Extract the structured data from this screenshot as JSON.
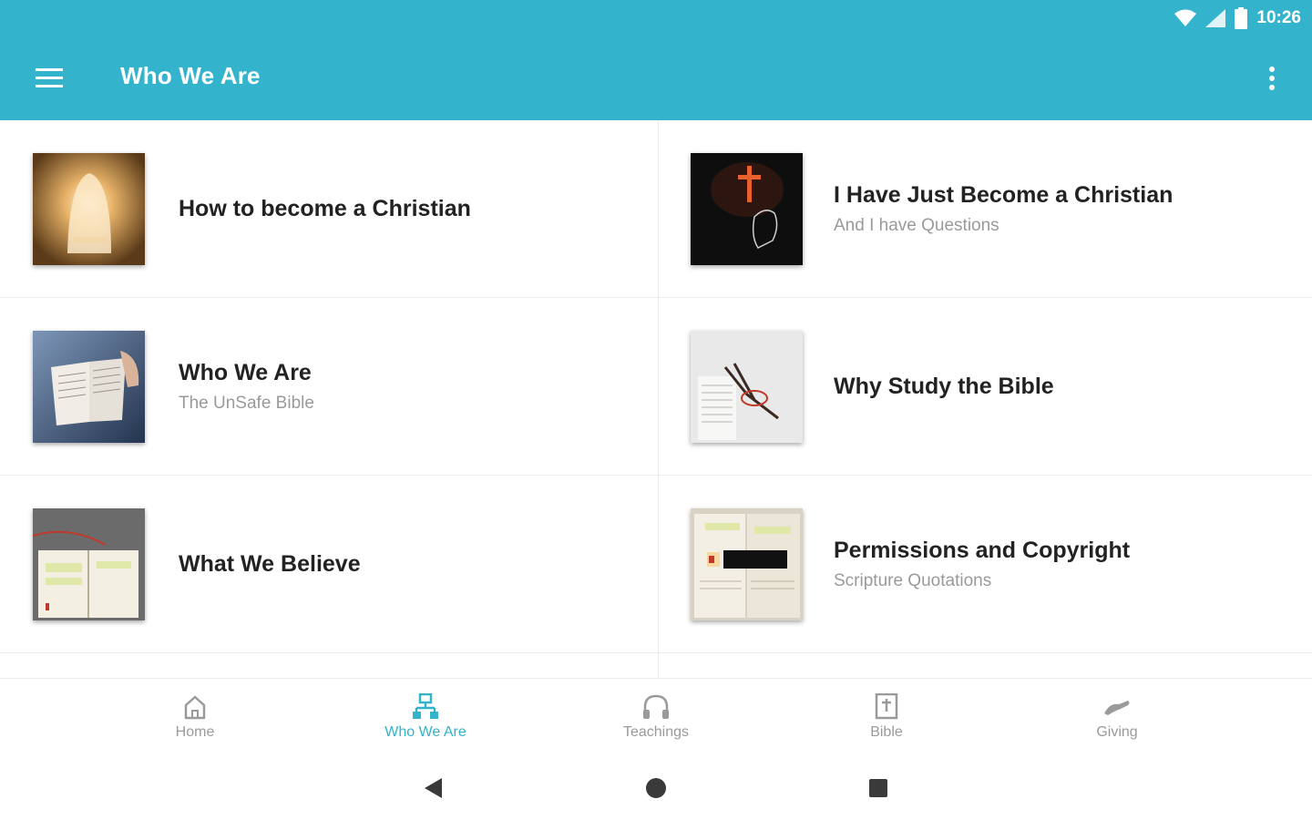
{
  "theme": {
    "accent": "#33b3cc",
    "active_nav": "#33b3cc",
    "inactive_nav": "#9a9a9a"
  },
  "status_bar": {
    "time": "10:26",
    "icons": [
      "wifi-icon",
      "signal-icon",
      "battery-icon"
    ]
  },
  "toolbar": {
    "title": "Who We Are",
    "menu_icon": "hamburger-menu-icon",
    "overflow_icon": "more-vertical-icon"
  },
  "items": [
    {
      "title": "How to become a Christian",
      "subtitle": "",
      "image": "tomb-light-thumbnail"
    },
    {
      "title": "I Have Just Become a Christian",
      "subtitle": "And I have Questions",
      "image": "cross-silhouette-thumbnail"
    },
    {
      "title": "Who We Are",
      "subtitle": "The UnSafe Bible",
      "image": "open-bible-hand-thumbnail"
    },
    {
      "title": "Why Study the Bible",
      "subtitle": "",
      "image": "glasses-on-book-thumbnail"
    },
    {
      "title": "What We Believe",
      "subtitle": "",
      "image": "highlighted-bible-thumbnail"
    },
    {
      "title": "Permissions and Copyright",
      "subtitle": "Scripture Quotations",
      "image": "bible-label-thumbnail"
    }
  ],
  "bottom_nav": [
    {
      "label": "Home",
      "icon": "home-icon",
      "active": false
    },
    {
      "label": "Who We Are",
      "icon": "org-chart-icon",
      "active": true
    },
    {
      "label": "Teachings",
      "icon": "headphones-icon",
      "active": false
    },
    {
      "label": "Bible",
      "icon": "bible-cross-icon",
      "active": false
    },
    {
      "label": "Giving",
      "icon": "giving-hand-icon",
      "active": false
    }
  ],
  "system_nav": {
    "back": "back-icon",
    "home": "home-circle-icon",
    "recents": "recents-square-icon"
  }
}
